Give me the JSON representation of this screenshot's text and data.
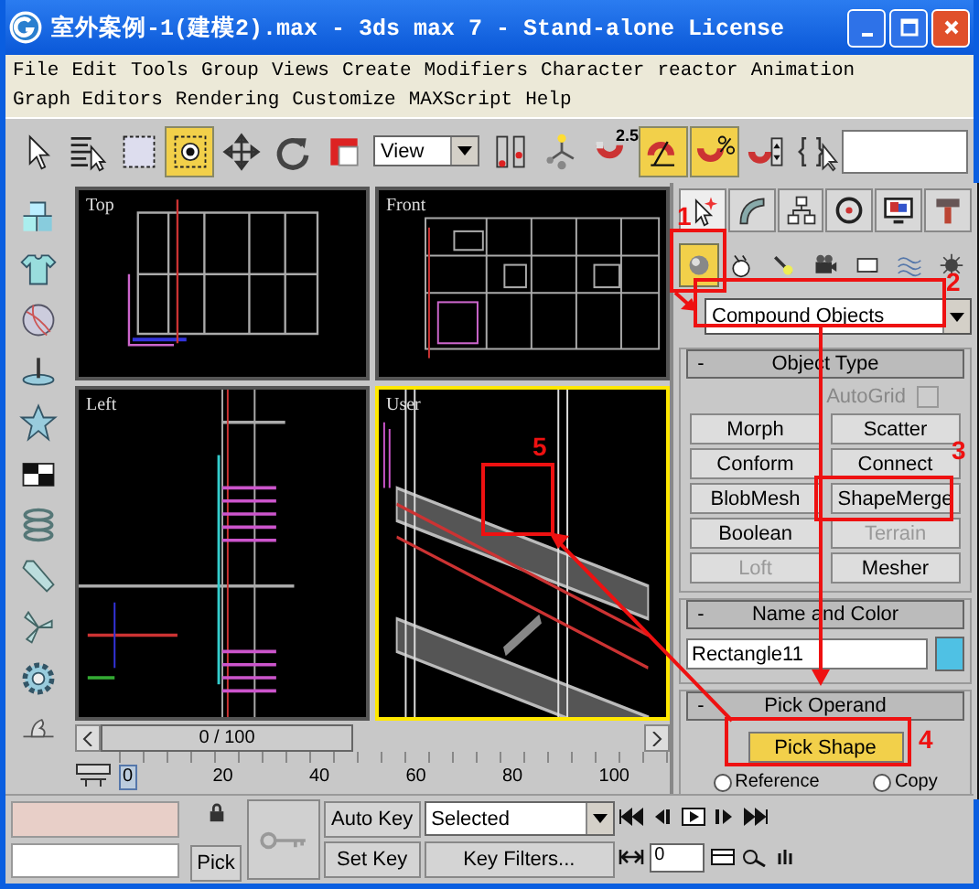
{
  "window": {
    "title": "室外案例-1(建模2).max - 3ds max 7  - Stand-alone License"
  },
  "menu_rows": [
    [
      "File",
      "Edit",
      "Tools",
      "Group",
      "Views",
      "Create",
      "Modifiers",
      "Character",
      "reactor",
      "Animation"
    ],
    [
      "Graph Editors",
      "Rendering",
      "Customize",
      "MAXScript",
      "Help"
    ]
  ],
  "toolbar": [
    {
      "kind": "select",
      "selected": false
    },
    {
      "kind": "select-name",
      "selected": false
    },
    {
      "kind": "region",
      "selected": false
    },
    {
      "kind": "window",
      "selected": true
    },
    {
      "kind": "move",
      "selected": false
    },
    {
      "kind": "rotate",
      "selected": false
    },
    {
      "kind": "scale",
      "selected": false
    },
    {
      "kind": "dropdown",
      "value": "View"
    },
    {
      "kind": "pivot",
      "selected": false
    },
    {
      "kind": "manipulate",
      "selected": false
    },
    {
      "kind": "snap",
      "value": "2.5",
      "selected": false
    },
    {
      "kind": "angle-snap",
      "selected": true
    },
    {
      "kind": "percent-snap",
      "selected": true
    },
    {
      "kind": "spinner-snap",
      "selected": false
    },
    {
      "kind": "named-sets",
      "selected": false
    }
  ],
  "viewports": [
    {
      "label": "Top",
      "kind": "plan",
      "active": false
    },
    {
      "label": "Front",
      "kind": "elevation",
      "active": false
    },
    {
      "label": "Left",
      "kind": "side",
      "active": false
    },
    {
      "label": "User",
      "kind": "perspective",
      "active": true
    }
  ],
  "time_slider": {
    "value": "0 / 100",
    "level": 0
  },
  "track_ticks": [
    "0",
    "20",
    "40",
    "60",
    "80",
    "100"
  ],
  "command_panel": {
    "tabs": [
      {
        "kind": "create",
        "selected": true
      },
      {
        "kind": "modify",
        "selected": false
      },
      {
        "kind": "hierarchy",
        "selected": false
      },
      {
        "kind": "motion",
        "selected": false
      },
      {
        "kind": "display",
        "selected": false
      },
      {
        "kind": "utilities",
        "selected": false
      }
    ],
    "categories": [
      {
        "kind": "geometry",
        "selected": true
      },
      {
        "kind": "shapes",
        "selected": false
      },
      {
        "kind": "lights",
        "selected": false
      },
      {
        "kind": "cameras",
        "selected": false
      },
      {
        "kind": "helpers",
        "selected": false
      },
      {
        "kind": "spacewarps",
        "selected": false
      },
      {
        "kind": "systems",
        "selected": false
      }
    ],
    "type_dropdown": "Compound Objects",
    "object_type": {
      "title": "Object Type",
      "toggle": "-",
      "autogrid": {
        "label": "AutoGrid",
        "disabled": true,
        "checked": false
      },
      "buttons": [
        {
          "label": "Morph",
          "disabled": false
        },
        {
          "label": "Scatter",
          "disabled": false
        },
        {
          "label": "Conform",
          "disabled": false
        },
        {
          "label": "Connect",
          "disabled": false
        },
        {
          "label": "BlobMesh",
          "disabled": false
        },
        {
          "label": "ShapeMerge",
          "disabled": false
        },
        {
          "label": "Boolean",
          "disabled": false
        },
        {
          "label": "Terrain",
          "disabled": true
        },
        {
          "label": "Loft",
          "disabled": true
        },
        {
          "label": "Mesher",
          "disabled": false
        }
      ]
    },
    "name_and_color": {
      "title": "Name and Color",
      "toggle": "-",
      "name": "Rectangle11",
      "color": "#4fc1e4"
    },
    "pick_operand": {
      "title": "Pick Operand",
      "toggle": "-",
      "button": {
        "label": "Pick Shape",
        "selected": true
      },
      "options": [
        {
          "label": "Reference",
          "selected": false
        },
        {
          "label": "Copy",
          "selected": false
        }
      ]
    }
  },
  "bottom": {
    "pick": "Pick",
    "auto_key": {
      "label": "Auto Key",
      "on": false
    },
    "set_key": "Set Key",
    "key_mode": "Selected",
    "key_filters": "Key Filters...",
    "frame": "0"
  },
  "annotations": [
    {
      "label": "1"
    },
    {
      "label": "2"
    },
    {
      "label": "3"
    },
    {
      "label": "4"
    },
    {
      "label": "5"
    }
  ]
}
